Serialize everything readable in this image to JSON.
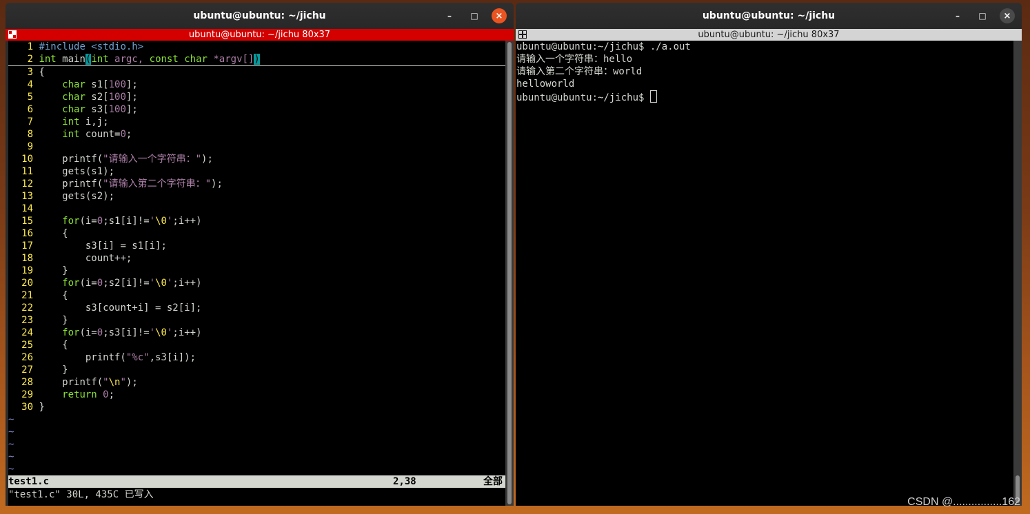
{
  "left_window": {
    "title": "ubuntu@ubuntu: ~/jichu",
    "xterm_title": "ubuntu@ubuntu: ~/jichu 80x37",
    "editor": {
      "lines": [
        {
          "n": "1"
        },
        {
          "n": "2"
        },
        {
          "n": "3",
          "t": "{"
        },
        {
          "n": "4"
        },
        {
          "n": "5"
        },
        {
          "n": "6"
        },
        {
          "n": "7"
        },
        {
          "n": "8"
        },
        {
          "n": "9",
          "t": ""
        },
        {
          "n": "10"
        },
        {
          "n": "11",
          "t": "    gets(s1);"
        },
        {
          "n": "12"
        },
        {
          "n": "13",
          "t": "    gets(s2);"
        },
        {
          "n": "14",
          "t": ""
        },
        {
          "n": "15"
        },
        {
          "n": "16",
          "t": "    {"
        },
        {
          "n": "17",
          "t": "        s3[i] = s1[i];"
        },
        {
          "n": "18",
          "t": "        count++;"
        },
        {
          "n": "19",
          "t": "    }"
        },
        {
          "n": "20"
        },
        {
          "n": "21",
          "t": "    {"
        },
        {
          "n": "22",
          "t": "        s3[count+i] = s2[i];"
        },
        {
          "n": "23",
          "t": "    }"
        },
        {
          "n": "24"
        },
        {
          "n": "25",
          "t": "    {"
        },
        {
          "n": "26"
        },
        {
          "n": "27",
          "t": "    }"
        },
        {
          "n": "28"
        },
        {
          "n": "29"
        },
        {
          "n": "30",
          "t": "}"
        }
      ],
      "code": {
        "l1_pp": "#include <stdio.h>",
        "l2_kw": "int",
        "l2_name": " main",
        "l2_paren": "(",
        "l2_kw2": "int",
        "l2_mid": " argc, ",
        "l2_kw3": "const char",
        "l2_rest": " *argv[]",
        "l2_close": ")",
        "l4_kw": "char",
        "l4_rest": " s1[",
        "l4_num": "100",
        "l4_end": "];",
        "l5_kw": "char",
        "l5_rest": " s2[",
        "l5_num": "100",
        "l5_end": "];",
        "l6_kw": "char",
        "l6_rest": " s3[",
        "l6_num": "100",
        "l6_end": "];",
        "l7_kw": "int",
        "l7_rest": " i,j;",
        "l8_kw": "int",
        "l8_rest": " count=",
        "l8_num": "0",
        "l8_end": ";",
        "l10_fn": "printf(",
        "l10_str": "\"请输入一个字符串：\"",
        "l10_end": ");",
        "l12_fn": "printf(",
        "l12_str": "\"请输入第二个字符串：\"",
        "l12_end": ");",
        "l15_kw": "for",
        "l15_a": "(i=",
        "l15_n": "0",
        "l15_b": ";s1[i]!=",
        "l15_q1": "'",
        "l15_esc": "\\0",
        "l15_q2": "'",
        "l15_c": ";i++)",
        "l20_kw": "for",
        "l20_a": "(i=",
        "l20_n": "0",
        "l20_b": ";s2[i]!=",
        "l20_q1": "'",
        "l20_esc": "\\0",
        "l20_q2": "'",
        "l20_c": ";i++)",
        "l24_kw": "for",
        "l24_a": "(i=",
        "l24_n": "0",
        "l24_b": ";s3[i]!=",
        "l24_q1": "'",
        "l24_esc": "\\0",
        "l24_q2": "'",
        "l24_c": ";i++)",
        "l26_fn": "printf(",
        "l26_str": "\"%c\"",
        "l26_end": ",s3[i]);",
        "l28_fn": "printf(",
        "l28_str1": "\"",
        "l28_esc": "\\n",
        "l28_str2": "\"",
        "l28_end": ");",
        "l29_kw": "return",
        "l29_sp": " ",
        "l29_num": "0",
        "l29_end": ";"
      },
      "tilde": "~",
      "status": {
        "file": "test1.c",
        "pos": "2,38",
        "scroll": "全部"
      },
      "cmdline": "\"test1.c\" 30L, 435C 已写入"
    }
  },
  "right_window": {
    "title": "ubuntu@ubuntu: ~/jichu",
    "xterm_title": "ubuntu@ubuntu: ~/jichu 80x37",
    "output": [
      "ubuntu@ubuntu:~/jichu$ ./a.out",
      "请输入一个字符串：hello",
      "请输入第二个字符串：world",
      "helloworld",
      "ubuntu@ubuntu:~/jichu$ "
    ]
  },
  "wm": {
    "minimize": "–",
    "maximize": "□",
    "close": "×"
  },
  "watermark": "CSDN @................162",
  "colors": {
    "accent": "#e95420",
    "xterm_active": "#d40000"
  }
}
